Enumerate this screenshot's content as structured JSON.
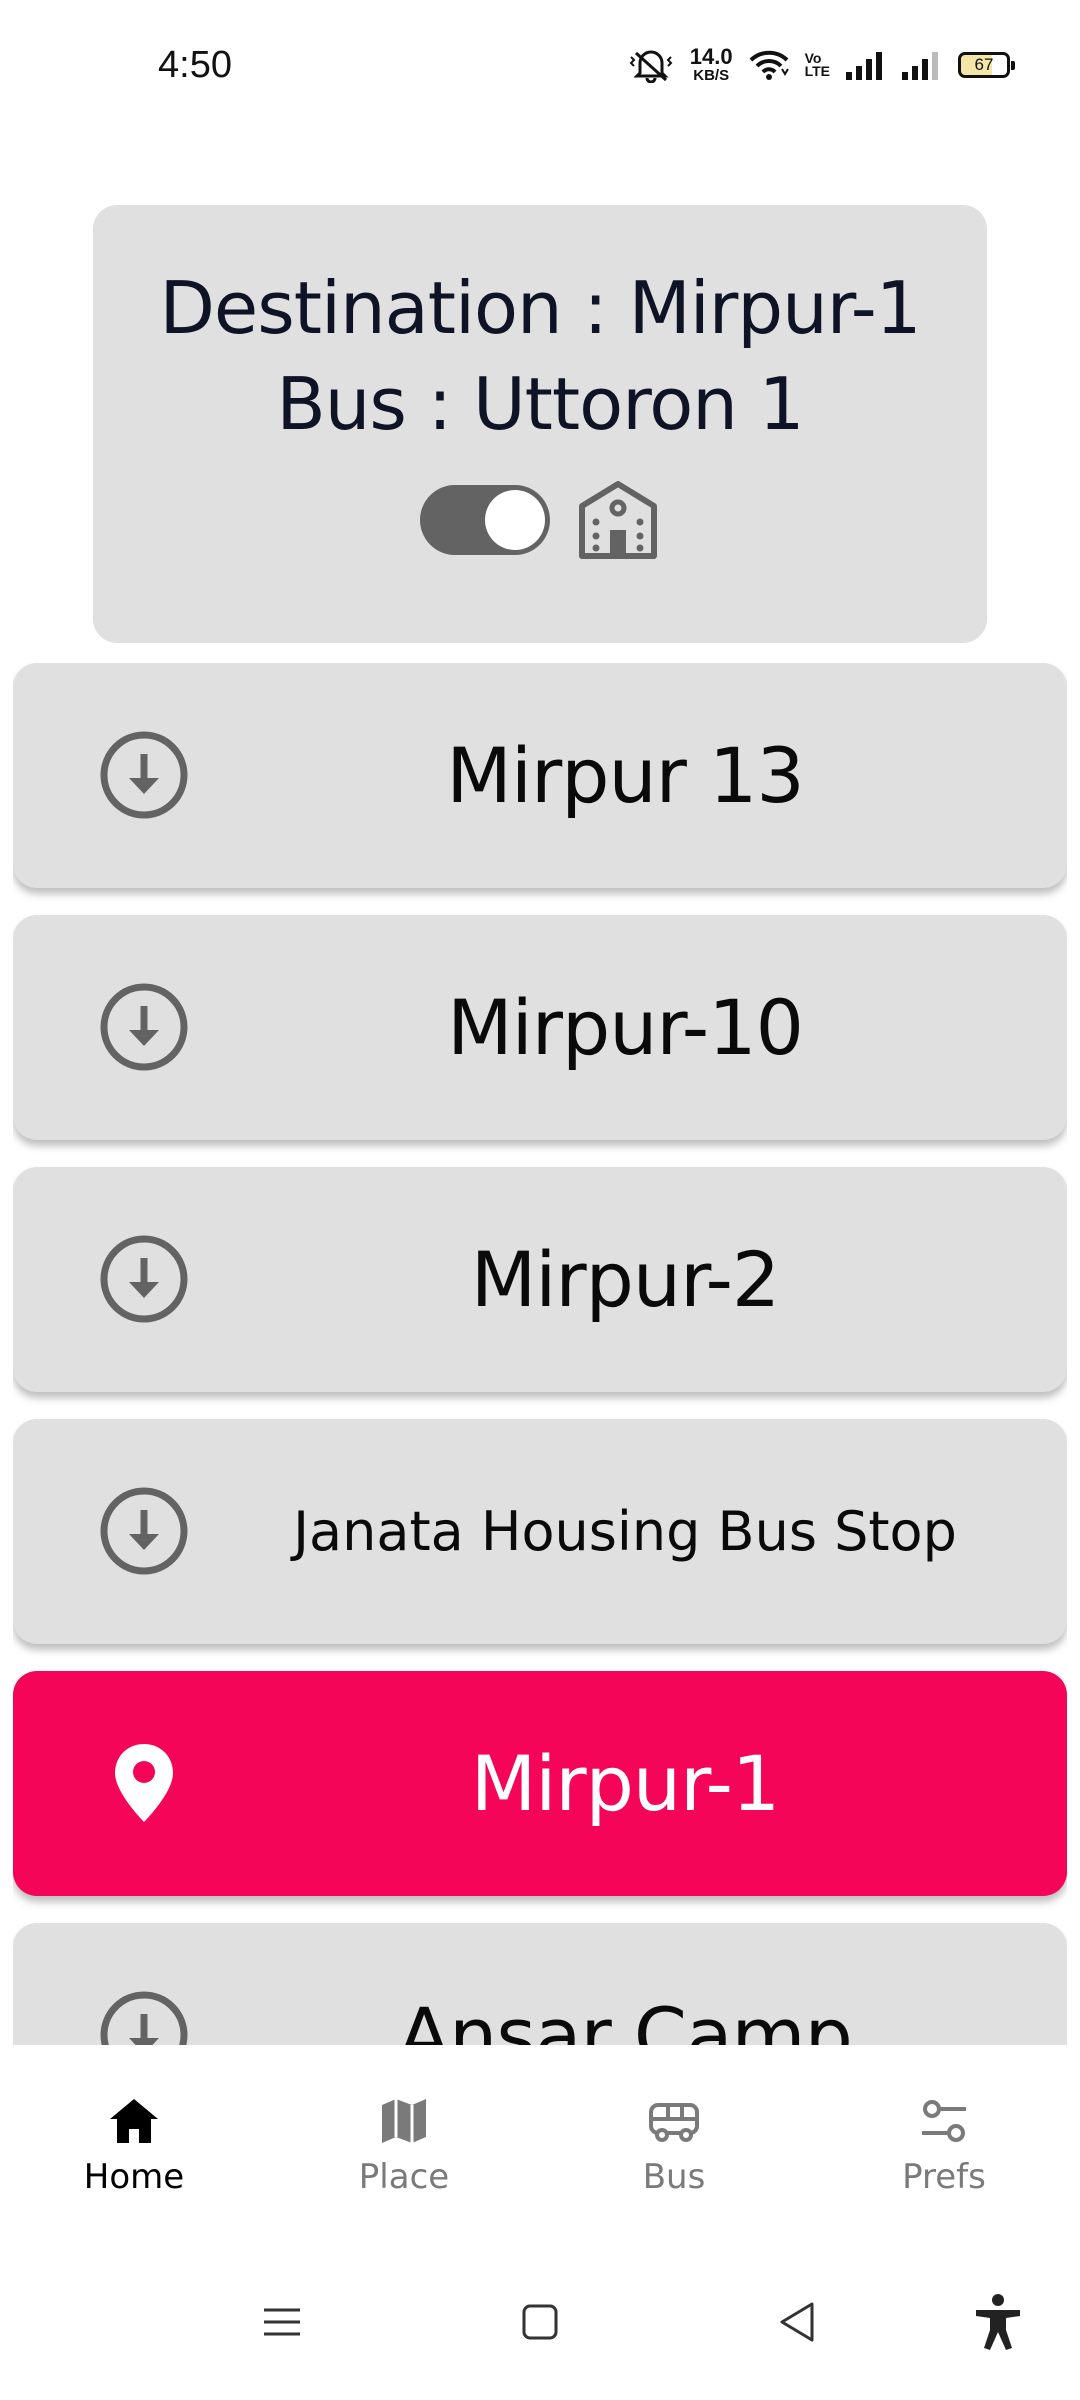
{
  "status_bar": {
    "time": "4:50",
    "net_speed_value": "14.0",
    "net_speed_unit": "KB/S",
    "volte_top": "Vo",
    "volte_bottom": "LTE",
    "battery_level": "67"
  },
  "header": {
    "destination_line": "Destination : Mirpur-1",
    "bus_line": "Bus : Uttoron 1",
    "toggle_on": true
  },
  "stops": [
    {
      "label": "Mirpur 13",
      "icon": "arrow-down-circle-icon",
      "active": false
    },
    {
      "label": "Mirpur-10",
      "icon": "arrow-down-circle-icon",
      "active": false
    },
    {
      "label": "Mirpur-2",
      "icon": "arrow-down-circle-icon",
      "active": false
    },
    {
      "label": "Janata Housing Bus Stop",
      "icon": "arrow-down-circle-icon",
      "active": false
    },
    {
      "label": "Mirpur-1",
      "icon": "location-pin-icon",
      "active": true
    },
    {
      "label": "Ansar Camp",
      "icon": "arrow-down-circle-icon",
      "active": false
    }
  ],
  "bottom_nav": {
    "items": [
      {
        "label": "Home",
        "icon": "home-icon",
        "selected": true
      },
      {
        "label": "Place",
        "icon": "map-icon",
        "selected": false
      },
      {
        "label": "Bus",
        "icon": "bus-icon",
        "selected": false
      },
      {
        "label": "Prefs",
        "icon": "sliders-icon",
        "selected": false
      }
    ]
  },
  "colors": {
    "accent": "#f50557",
    "card_bg": "#e0e0e0",
    "icon_gray": "#636363",
    "text_dark": "#0e1325"
  }
}
